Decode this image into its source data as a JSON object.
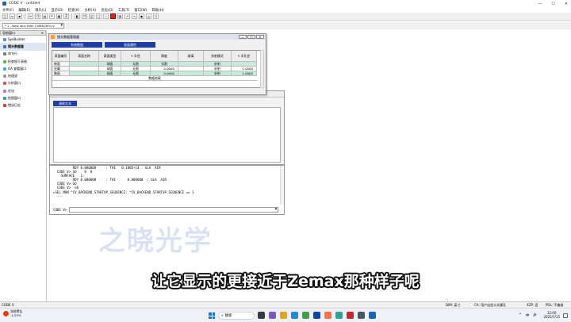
{
  "app": {
    "title": "CODE V - untitled",
    "win_controls": [
      "—",
      "☐",
      "✕"
    ]
  },
  "menu": [
    "文件(F)",
    "编辑(E)",
    "镜头(L)",
    "显示(D)",
    "检查(K)",
    "分析(A)",
    "优化(O)",
    "工具(T)",
    "窗口(W)",
    "帮助(H)"
  ],
  "lens_selector": {
    "value": "* 1 - New lens from CVMACRO:cv"
  },
  "sidebar": {
    "header": "导航窗口",
    "close": "✕",
    "items": [
      {
        "label": "SpeBuilder",
        "color": "#5a8fd6"
      },
      {
        "label": "镜头数据管",
        "color": "#3a6fc6",
        "selected": true
      },
      {
        "label": "命令行",
        "color": "#7a7a7a"
      },
      {
        "label": "检查相干表格",
        "color": "#6ab04c"
      },
      {
        "label": "OA 查看窗口",
        "color": "#4aa3df"
      },
      {
        "label": "快速说",
        "color": "#999999"
      },
      {
        "label": "分析窗口",
        "color": "#e0504a"
      },
      {
        "label": "优化",
        "color": "#c07ad6"
      },
      {
        "label": "绘图窗口",
        "color": "#3aa0a0"
      },
      {
        "label": "错误日志",
        "color": "#d04040"
      }
    ]
  },
  "lens_data_manager": {
    "title": "镜头数据管理器",
    "window_buttons": [
      "—",
      "☐",
      "✕"
    ],
    "tabs": [
      "系统数据",
      "表面属性"
    ],
    "columns": [
      "表面编号",
      "表面名称",
      "表面类型",
      "Y 半径",
      "厚度",
      "玻璃",
      "折射模式",
      "Y 半孔径"
    ],
    "rows": [
      [
        "物面",
        "",
        "球面",
        "无限",
        "无限",
        "",
        "折射",
        ""
      ],
      [
        "光阑",
        "",
        "球面",
        "无限",
        "0.0000",
        "",
        "折射",
        "1.0000"
      ],
      [
        "像面",
        "",
        "球面",
        "无限",
        "0.0000",
        "",
        "折射",
        "1.0000"
      ]
    ],
    "footer": "数据结尾"
  },
  "text_window": {
    "clear_button": "清除文本"
  },
  "command_window": {
    "output_lines": [
      "          RDY 0.000000     : THI   0.100E+14 : GLA  AIR",
      "  CODE V> SO    0  0",
      "    SURFACE   1:",
      "          RDY 0.000000     : THI      0.000000  : GLA  AIR",
      "  CODE V> GO",
      "  CODE V>  GO",
      "▸SEL MON ^CV_BACKEND_STARTUP_SEQUENCE: ^CV_BACKEND_STARTUP_SEQUENCE == 1",
      "  ---"
    ],
    "prompt": "CODE V>",
    "input_value": ""
  },
  "watermark": "之晓光学",
  "subtitle": "让它显示的更接近于Zemax那种样子呢",
  "statusbar": {
    "left": "CODE V",
    "dim": "DIM: 英寸",
    "ca": "CA: 用户自定义光阑孔",
    "xzp": "XZP: 否",
    "pol": "POL: 不偏振"
  },
  "taskbar": {
    "weather_title": "冻结警告",
    "weather_temp": "-1.03%",
    "search_label": "搜索",
    "tray": [
      "^",
      "中",
      "🔊"
    ],
    "time": "12:00",
    "date": "2025/7/15"
  }
}
